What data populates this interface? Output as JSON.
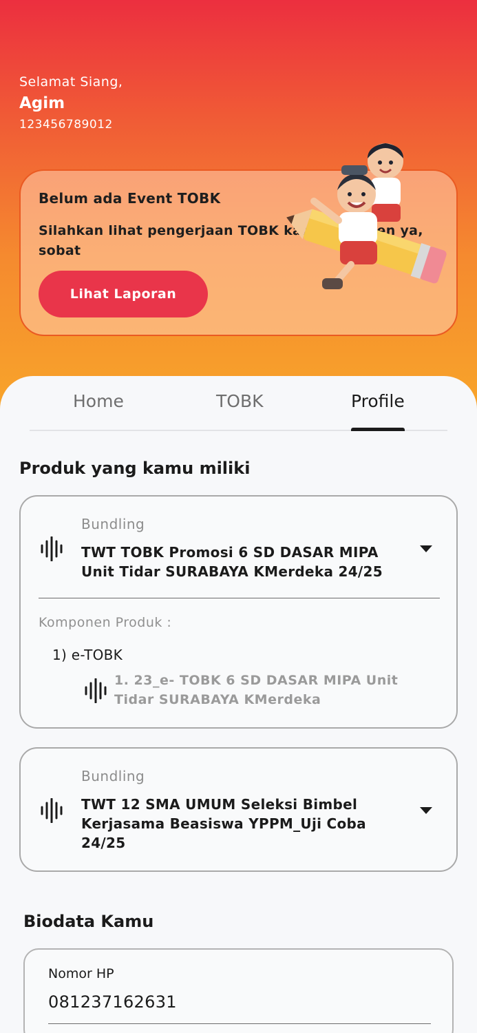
{
  "header": {
    "greeting": "Selamat Siang,",
    "name": "Agim",
    "id_number": "123456789012"
  },
  "event_card": {
    "title": "Belum ada Event TOBK",
    "description": "Silahkan lihat pengerjaan TOBK kamu kemaren ya, sobat",
    "button_label": "Lihat Laporan",
    "illustration": "kids-riding-pencil-illustration"
  },
  "tabs": [
    {
      "label": "Home",
      "active": false
    },
    {
      "label": "TOBK",
      "active": false
    },
    {
      "label": "Profile",
      "active": true
    }
  ],
  "products": {
    "title": "Produk yang kamu miliki",
    "items": [
      {
        "type_label": "Bundling",
        "name": "TWT TOBK Promosi 6 SD DASAR MIPA Unit Tidar SURABAYA KMerdeka 24/25",
        "icon": "sound-wave-icon",
        "expanded": true,
        "components_label": "Komponen Produk :",
        "components": [
          {
            "label": "1) e-TOBK",
            "items": [
              "1. 23_e- TOBK 6 SD DASAR MIPA Unit Tidar SURABAYA KMerdeka"
            ]
          }
        ]
      },
      {
        "type_label": "Bundling",
        "name": "TWT 12 SMA UMUM Seleksi Bimbel Kerjasama Beasiswa YPPM_Uji Coba 24/25",
        "icon": "sound-wave-icon",
        "expanded": false
      }
    ]
  },
  "biodata": {
    "title": "Biodata Kamu",
    "phone_label": "Nomor HP",
    "phone_value": "081237162631"
  },
  "colors": {
    "header_gradient_top": "#ec2f3f",
    "header_gradient_bottom": "#f8a52a",
    "button_red": "#e9354a",
    "card_border_orange": "#ea5a22"
  }
}
